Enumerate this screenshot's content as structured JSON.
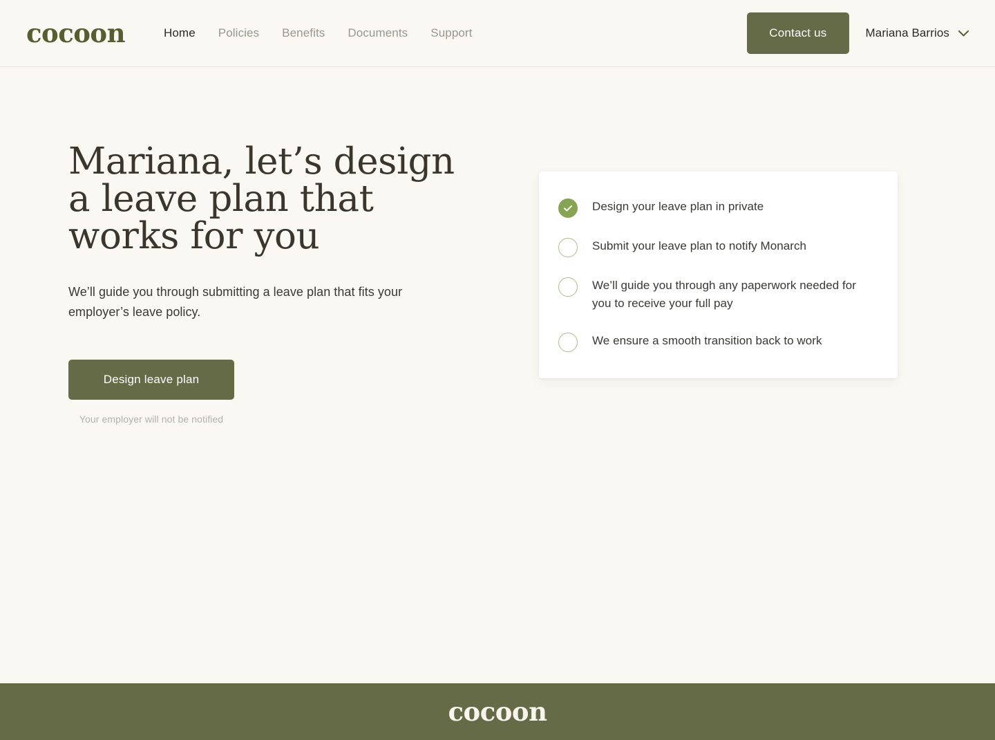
{
  "brand": {
    "name": "cocoon",
    "logo_color": "#565E32",
    "footer_logo_color": "#F7F5EE"
  },
  "theme": {
    "page_background": "#F9F8F3",
    "accent_olive": "#666B47",
    "accent_green": "#87A455",
    "circle_outline": "#A8BE84",
    "heading_color": "#3B362D",
    "body_color": "#3A3833",
    "muted_color": "#9B968D",
    "note_color": "#B6B1A8",
    "card_background": "#FFFFFF"
  },
  "header": {
    "nav": [
      {
        "label": "Home",
        "active": true
      },
      {
        "label": "Policies",
        "active": false
      },
      {
        "label": "Benefits",
        "active": false
      },
      {
        "label": "Documents",
        "active": false
      },
      {
        "label": "Support",
        "active": false
      }
    ],
    "contact_button": "Contact us",
    "user_name": "Mariana Barrios",
    "chevron_icon": "chevron-down-icon"
  },
  "hero": {
    "title": "Mariana, let’s design a leave plan that works for you",
    "subtitle": "We’ll guide you through submitting a leave plan that fits your employer’s leave policy.",
    "cta_label": "Design leave plan",
    "cta_note": "Your employer will not be notified"
  },
  "checklist": {
    "items": [
      {
        "text": "Design your leave plan in private",
        "state": "done",
        "icon": "check-icon"
      },
      {
        "text": "Submit your leave plan to notify Monarch",
        "state": "todo",
        "icon": "empty-circle-icon"
      },
      {
        "text": "We’ll guide you through any paperwork needed for you to receive your full pay",
        "state": "todo",
        "icon": "empty-circle-icon"
      },
      {
        "text": "We ensure a smooth transition back to work",
        "state": "todo",
        "icon": "empty-circle-icon"
      }
    ]
  },
  "footer": {
    "brand": "cocoon"
  }
}
